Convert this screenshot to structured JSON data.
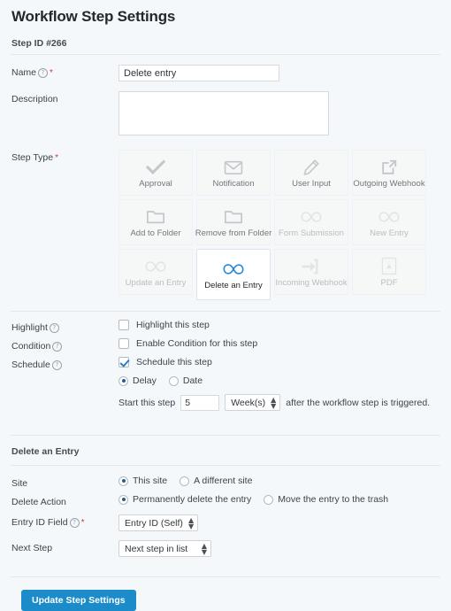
{
  "header": {
    "title": "Workflow Step Settings",
    "step_id": "Step ID #266"
  },
  "fields": {
    "name": {
      "label": "Name",
      "value": "Delete entry",
      "placeholder": "",
      "required": true,
      "has_help": true
    },
    "description": {
      "label": "Description",
      "value": "",
      "placeholder": ""
    },
    "step_type": {
      "label": "Step Type",
      "required": true,
      "selected": "Delete an Entry",
      "tiles": [
        {
          "label": "Approval",
          "icon": "check-icon",
          "state": "normal"
        },
        {
          "label": "Notification",
          "icon": "envelope-icon",
          "state": "normal"
        },
        {
          "label": "User Input",
          "icon": "pencil-icon",
          "state": "normal"
        },
        {
          "label": "Outgoing Webhook",
          "icon": "external-link-icon",
          "state": "normal"
        },
        {
          "label": "Add to Folder",
          "icon": "folder-icon",
          "state": "normal"
        },
        {
          "label": "Remove from Folder",
          "icon": "folder-icon",
          "state": "normal"
        },
        {
          "label": "Form Submission",
          "icon": "link-icon",
          "state": "dim"
        },
        {
          "label": "New Entry",
          "icon": "link-icon",
          "state": "dim"
        },
        {
          "label": "Update an Entry",
          "icon": "link-icon",
          "state": "dim"
        },
        {
          "label": "Delete an Entry",
          "icon": "link-icon",
          "state": "selected"
        },
        {
          "label": "Incoming Webhook",
          "icon": "arrow-into-box-icon",
          "state": "dim"
        },
        {
          "label": "PDF",
          "icon": "pdf-icon",
          "state": "dim"
        }
      ]
    },
    "highlight": {
      "label": "Highlight",
      "has_help": true,
      "checkbox_label": "Highlight this step",
      "checked": false
    },
    "condition": {
      "label": "Condition",
      "has_help": true,
      "checkbox_label": "Enable Condition for this step",
      "checked": false
    },
    "schedule": {
      "label": "Schedule",
      "has_help": true,
      "checkbox_label": "Schedule this step",
      "checked": true,
      "mode_options": [
        "Delay",
        "Date"
      ],
      "mode_selected": "Delay",
      "delay_prefix": "Start this step",
      "delay_value": "5",
      "delay_unit": "Week(s)",
      "delay_suffix": "after the workflow step is triggered."
    }
  },
  "delete_section": {
    "title": "Delete an Entry",
    "site": {
      "label": "Site",
      "options": [
        "This site",
        "A different site"
      ],
      "selected": "This site"
    },
    "delete_action": {
      "label": "Delete Action",
      "options": [
        "Permanently delete the entry",
        "Move the entry to the trash"
      ],
      "selected": "Permanently delete the entry"
    },
    "entry_id_field": {
      "label": "Entry ID Field",
      "has_help": true,
      "required": true,
      "selected": "Entry ID (Self)"
    },
    "next_step": {
      "label": "Next Step",
      "selected": "Next step in list"
    }
  },
  "footer": {
    "submit_label": "Update Step Settings"
  },
  "colors": {
    "accent": "#1b8cc9",
    "required": "#d63638",
    "background": "#f4f8fb",
    "tile": "#f6f7f7"
  }
}
